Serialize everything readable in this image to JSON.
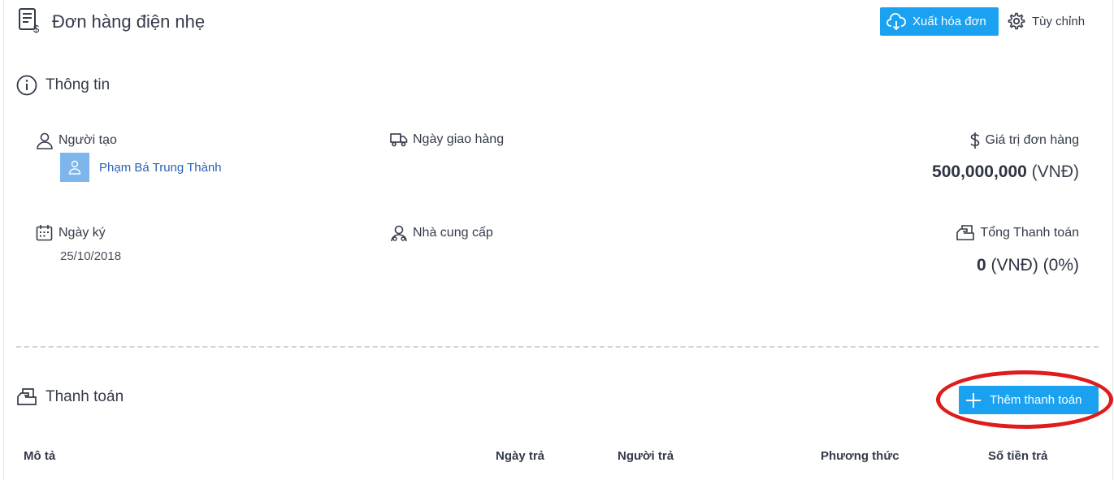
{
  "header": {
    "title": "Đơn hàng điện nhẹ",
    "export_label": "Xuất hóa đơn",
    "custom_label": "Tùy chỉnh"
  },
  "info": {
    "heading": "Thông tin",
    "creator_label": "Người tạo",
    "creator_name": "Phạm Bá Trung Thành",
    "delivery_label": "Ngày giao hàng",
    "order_value_label": "Giá trị đơn hàng",
    "order_value": "500,000,000",
    "order_value_unit": "(VNĐ)",
    "sign_label": "Ngày ký",
    "sign_date": "25/10/2018",
    "supplier_label": "Nhà cung cấp",
    "total_paid_label": "Tổng Thanh toán",
    "total_paid_value": "0",
    "total_paid_unit": "(VNĐ) (0%)"
  },
  "payment": {
    "heading": "Thanh toán",
    "add_label": "Thêm thanh toán",
    "columns": [
      "Mô tả",
      "Ngày trả",
      "Người trả",
      "Phương thức",
      "Số tiền trả"
    ]
  },
  "colors": {
    "accent": "#1aa1f0",
    "link": "#2a63b0",
    "highlight": "#e01b1b"
  }
}
